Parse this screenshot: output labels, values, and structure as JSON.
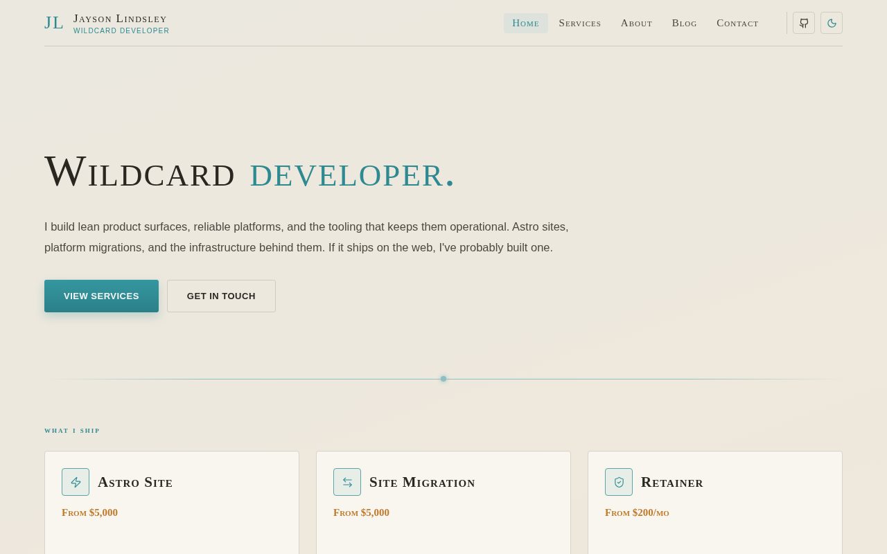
{
  "header": {
    "monogram": "JL",
    "name": "Jayson Lindsley",
    "tagline": "WILDCARD DEVELOPER",
    "nav": [
      {
        "label": "Home",
        "selected": true
      },
      {
        "label": "Services",
        "selected": false
      },
      {
        "label": "About",
        "selected": false
      },
      {
        "label": "Blog",
        "selected": false
      },
      {
        "label": "Contact",
        "selected": false
      }
    ],
    "icon_buttons": [
      {
        "kind": "github"
      },
      {
        "kind": "theme"
      }
    ]
  },
  "hero": {
    "title": "Wildcard",
    "title_accent": "developer.",
    "intro": "I build lean product surfaces, reliable platforms, and the tooling that keeps them operational. Astro sites, platform migrations, and the infrastructure behind them. If it ships on the web, I've probably built one.",
    "buttons": [
      {
        "label": "VIEW SERVICES",
        "kind": "primary"
      },
      {
        "label": "GET IN TOUCH",
        "kind": "secondary"
      }
    ]
  },
  "services": {
    "eyebrow": "what i ship",
    "cards": [
      {
        "kind": "bolt",
        "title": "Astro Site",
        "price": "From $5,000"
      },
      {
        "kind": "arrows",
        "title": "Site Migration",
        "price": "From $5,000"
      },
      {
        "kind": "shield",
        "title": "Retainer",
        "price": "From $200/mo"
      }
    ]
  }
}
